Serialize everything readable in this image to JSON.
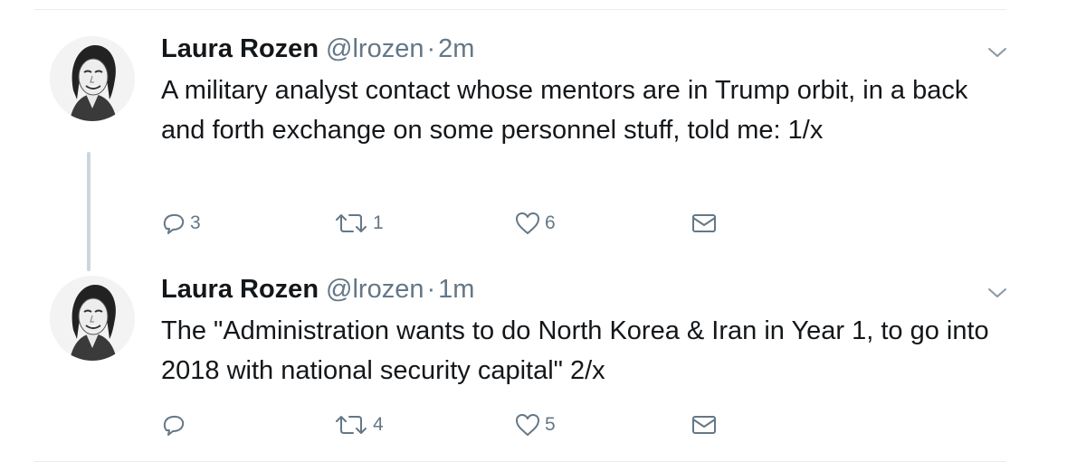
{
  "tweets": [
    {
      "name": "Laura Rozen",
      "handle": "@lrozen",
      "separator": "·",
      "time": "2m",
      "text": "A military analyst contact whose mentors are in Trump orbit, in a back and forth exchange on some personnel stuff, told me: 1/x",
      "replies": "3",
      "retweets": "1",
      "likes": "6"
    },
    {
      "name": "Laura Rozen",
      "handle": "@lrozen",
      "separator": "·",
      "time": "1m",
      "text": "The \"Administration wants to do North Korea & Iran in Year 1, to go into 2018 with national security capital\" 2/x",
      "replies": "",
      "retweets": "4",
      "likes": "5"
    }
  ],
  "icons": {
    "reply": "reply-icon",
    "retweet": "retweet-icon",
    "like": "heart-icon",
    "message": "envelope-icon",
    "menu": "chevron-down-icon"
  },
  "colors": {
    "text": "#14171a",
    "secondary": "#657786",
    "divider": "#e6ecf0",
    "thread_line": "#ccd6dd"
  }
}
